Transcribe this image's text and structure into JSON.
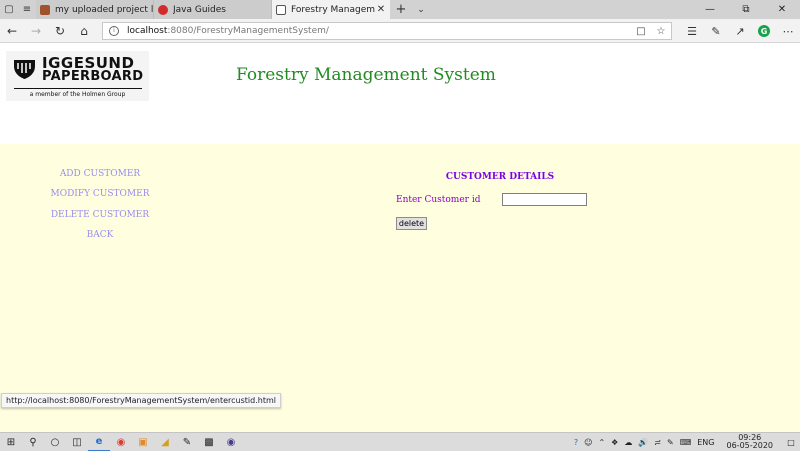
{
  "browser": {
    "tabs": [
      {
        "title": "my uploaded project list.do",
        "favicon_color": "#a0522d",
        "active": false
      },
      {
        "title": "Java Guides",
        "favicon_color": "#d22b2b",
        "active": false
      },
      {
        "title": "Forestry Management S",
        "favicon_color": "#ffffff",
        "active": true
      }
    ],
    "address_host": "localhost",
    "address_rest": ":8080/ForestryManagementSystem/"
  },
  "page": {
    "logo_line1": "IGGESUND",
    "logo_line2": "PAPERBOARD",
    "logo_tagline": "a member of the Holmen Group",
    "title": "Forestry Management System",
    "menu": [
      {
        "label": "ADD CUSTOMER"
      },
      {
        "label": "MODIFY CUSTOMER"
      },
      {
        "label": "DELETE CUSTOMER"
      },
      {
        "label": "BACK"
      }
    ],
    "panel_title": "CUSTOMER DETAILS",
    "customer_id_label": "Enter Customer id",
    "customer_id_value": "",
    "delete_label": "delete",
    "title_color": "#228b22",
    "menu_color": "#9a8cf0",
    "content_bg": "#ffffe0"
  },
  "status_url": "http://localhost:8080/ForestryManagementSystem/entercustid.html",
  "taskbar": {
    "language": "ENG",
    "time": "09:26",
    "date": "06-05-2020"
  }
}
